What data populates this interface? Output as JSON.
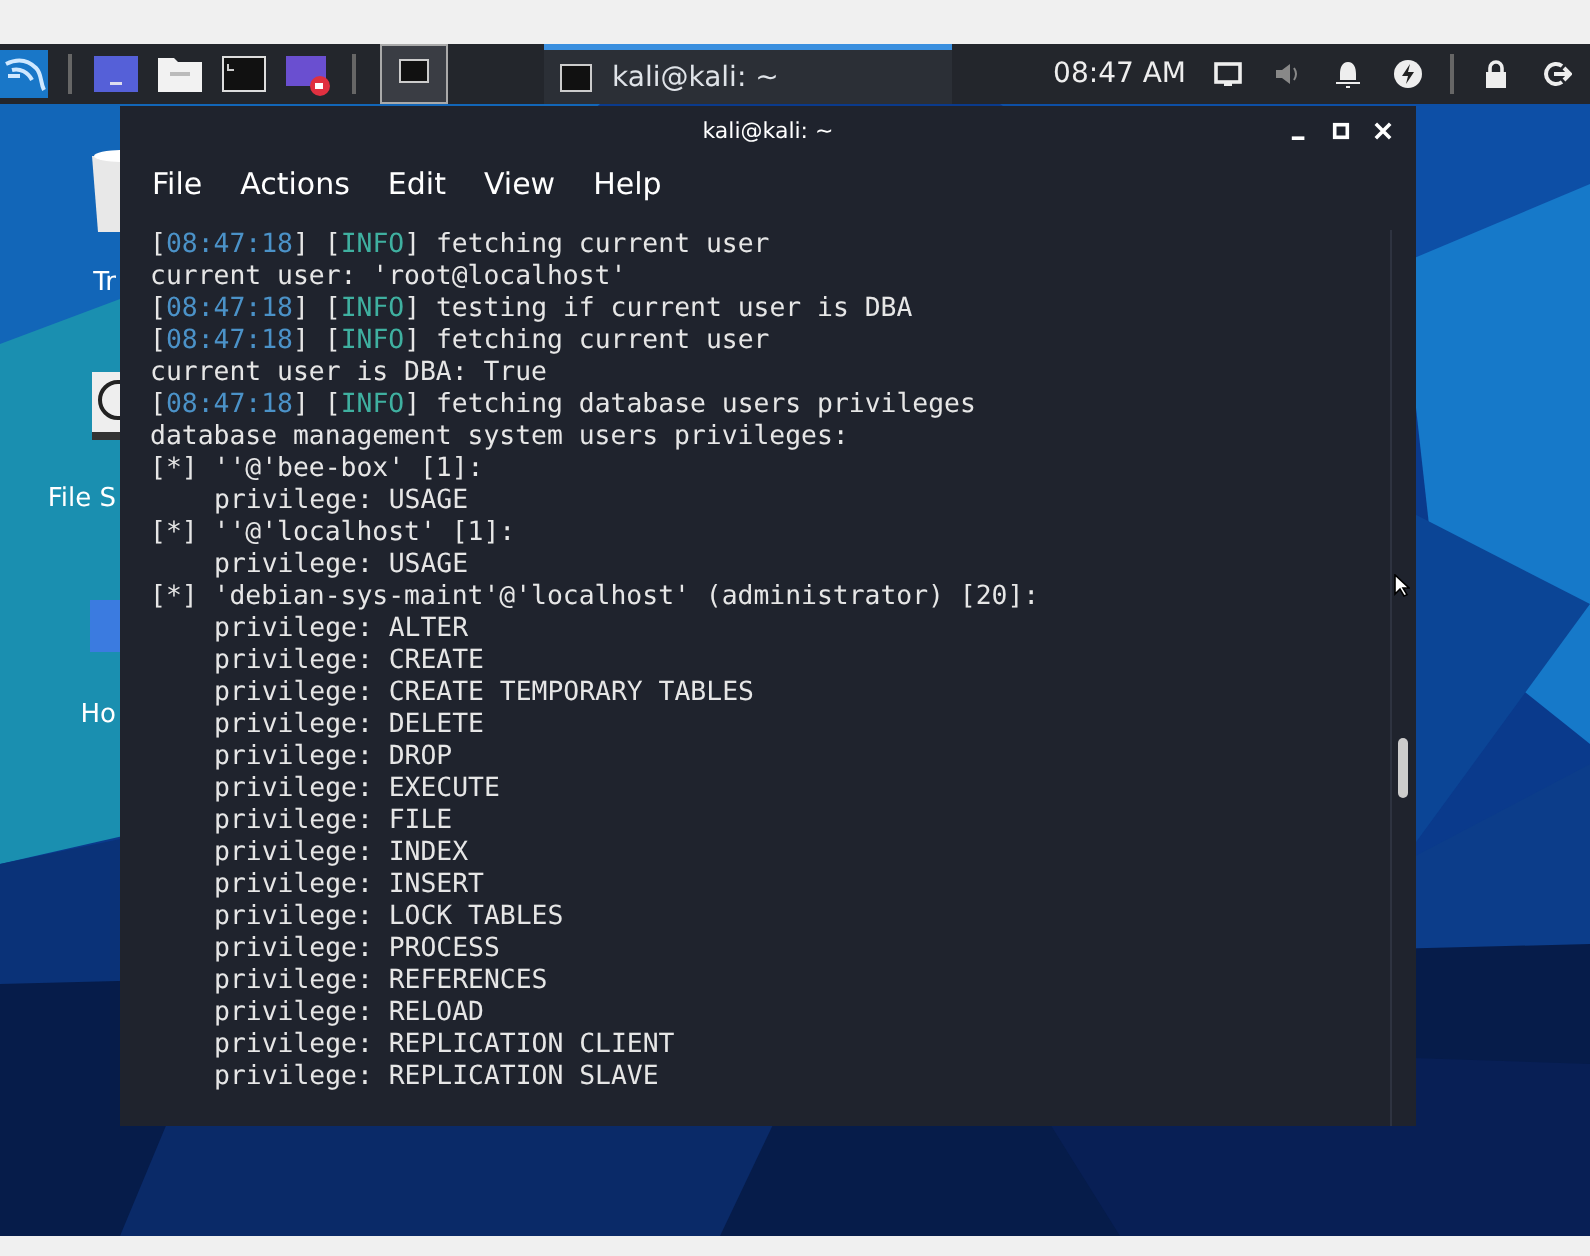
{
  "taskbar": {
    "task": {
      "title": "kali@kali: ~",
      "selected": true
    },
    "clock": "08:47 AM"
  },
  "desktop_icons": [
    {
      "kind": "trash",
      "label": "Tr"
    },
    {
      "kind": "drive",
      "label": "File S"
    },
    {
      "kind": "home",
      "label": "Ho"
    }
  ],
  "window": {
    "title": "kali@kali: ~",
    "menu": [
      "File",
      "Actions",
      "Edit",
      "View",
      "Help"
    ],
    "lines": [
      {
        "kind": "info",
        "stamp": [
          "[",
          "08:47:18",
          "] [",
          "INFO",
          "]"
        ],
        "text": "fetching current user"
      },
      {
        "kind": "plain",
        "text": "current user: 'root@localhost'"
      },
      {
        "kind": "info",
        "stamp": [
          "[",
          "08:47:18",
          "] [",
          "INFO",
          "]"
        ],
        "text": "testing if current user is DBA"
      },
      {
        "kind": "info",
        "stamp": [
          "[",
          "08:47:18",
          "] [",
          "INFO",
          "]"
        ],
        "text": "fetching current user"
      },
      {
        "kind": "plain",
        "text": "current user is DBA: True"
      },
      {
        "kind": "info",
        "stamp": [
          "[",
          "08:47:18",
          "] [",
          "INFO",
          "]"
        ],
        "text": "fetching database users privileges"
      },
      {
        "kind": "plain",
        "text": "database management system users privileges:"
      },
      {
        "kind": "plain",
        "text": "[*] ''@'bee-box' [1]:"
      },
      {
        "kind": "indented",
        "text": "privilege: USAGE"
      },
      {
        "kind": "plain",
        "text": "[*] ''@'localhost' [1]:"
      },
      {
        "kind": "indented",
        "text": "privilege: USAGE"
      },
      {
        "kind": "plain",
        "text": "[*] 'debian-sys-maint'@'localhost' (administrator) [20]:"
      },
      {
        "kind": "indented",
        "text": "privilege: ALTER"
      },
      {
        "kind": "indented",
        "text": "privilege: CREATE"
      },
      {
        "kind": "indented",
        "text": "privilege: CREATE TEMPORARY TABLES"
      },
      {
        "kind": "indented",
        "text": "privilege: DELETE"
      },
      {
        "kind": "indented",
        "text": "privilege: DROP"
      },
      {
        "kind": "indented",
        "text": "privilege: EXECUTE"
      },
      {
        "kind": "indented",
        "text": "privilege: FILE"
      },
      {
        "kind": "indented",
        "text": "privilege: INDEX"
      },
      {
        "kind": "indented",
        "text": "privilege: INSERT"
      },
      {
        "kind": "indented",
        "text": "privilege: LOCK TABLES"
      },
      {
        "kind": "indented",
        "text": "privilege: PROCESS"
      },
      {
        "kind": "indented",
        "text": "privilege: REFERENCES"
      },
      {
        "kind": "indented",
        "text": "privilege: RELOAD"
      },
      {
        "kind": "indented",
        "text": "privilege: REPLICATION CLIENT"
      },
      {
        "kind": "indented",
        "text": "privilege: REPLICATION SLAVE"
      }
    ]
  }
}
